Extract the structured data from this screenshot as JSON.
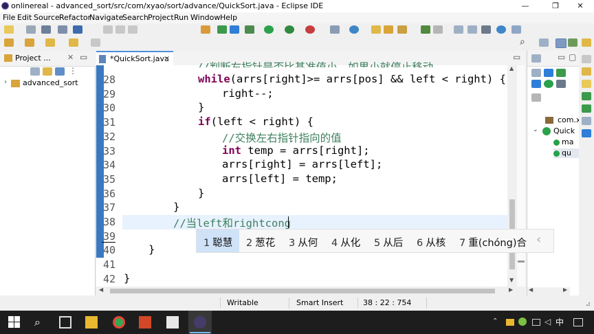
{
  "window": {
    "title": "onlinereal - advanced_sort/src/com/xyao/sort/advance/QuickSort.java - Eclipse IDE"
  },
  "menu": [
    "File",
    "Edit",
    "Source",
    "Refactor",
    "Navigate",
    "Search",
    "Project",
    "Run",
    "Window",
    "Help"
  ],
  "project_explorer": {
    "tab_label": "Project ...",
    "tree": [
      "advanced_sort"
    ]
  },
  "editor": {
    "tab_label": "*QuickSort.java",
    "lines": [
      {
        "n": "28",
        "code": [
          {
            "t": "kw",
            "v": "while"
          },
          {
            "t": "",
            "v": "(arrs[right]>= arrs[pos] && left < right) {"
          }
        ]
      },
      {
        "n": "29",
        "code": [
          {
            "t": "",
            "v": "right--;"
          }
        ]
      },
      {
        "n": "30",
        "code": [
          {
            "t": "",
            "v": "}"
          }
        ]
      },
      {
        "n": "31",
        "code": [
          {
            "t": "kw",
            "v": "if"
          },
          {
            "t": "",
            "v": "(left < right) {"
          }
        ]
      },
      {
        "n": "32",
        "code": [
          {
            "t": "cm",
            "v": "//交换左右指针指向的值"
          }
        ]
      },
      {
        "n": "33",
        "code": [
          {
            "t": "kw",
            "v": "int"
          },
          {
            "t": "",
            "v": " temp = arrs[right];"
          }
        ]
      },
      {
        "n": "34",
        "code": [
          {
            "t": "",
            "v": "arrs[right] = arrs[left];"
          }
        ]
      },
      {
        "n": "35",
        "code": [
          {
            "t": "",
            "v": "arrs[left] = temp;"
          }
        ]
      },
      {
        "n": "36",
        "code": [
          {
            "t": "",
            "v": "}"
          }
        ]
      },
      {
        "n": "37",
        "code": [
          {
            "t": "",
            "v": "}"
          }
        ]
      },
      {
        "n": "38",
        "code": [
          {
            "t": "cm",
            "v": "//当left和rightcong"
          }
        ]
      },
      {
        "n": "39",
        "code": []
      },
      {
        "n": "40",
        "code": [
          {
            "t": "",
            "v": "}"
          }
        ]
      },
      {
        "n": "41",
        "code": []
      },
      {
        "n": "42",
        "code": [
          {
            "t": "",
            "v": "}"
          }
        ]
      }
    ],
    "partial_top_comment": "//判断右指针是否比基准值小，如果小就停止移动"
  },
  "outline": {
    "items": [
      "com.x",
      "Quick",
      "ma",
      "qu"
    ]
  },
  "ime": {
    "candidates": [
      {
        "num": "1",
        "text": "聪慧"
      },
      {
        "num": "2",
        "text": "葱花"
      },
      {
        "num": "3",
        "text": "从何"
      },
      {
        "num": "4",
        "text": "从化"
      },
      {
        "num": "5",
        "text": "从后"
      },
      {
        "num": "6",
        "text": "从核"
      },
      {
        "num": "7",
        "text": "重(chóng)合"
      }
    ],
    "prev_arrow": "‹"
  },
  "status": {
    "writable": "Writable",
    "insert_mode": "Smart Insert",
    "position": "38 : 22 : 754"
  },
  "taskbar": {
    "ime_indicator": "中"
  },
  "colors": {
    "keyword": "#7f0055",
    "comment": "#3f7f5f",
    "current_line": "#e8f2fe",
    "ruler": "#3b78c2"
  }
}
